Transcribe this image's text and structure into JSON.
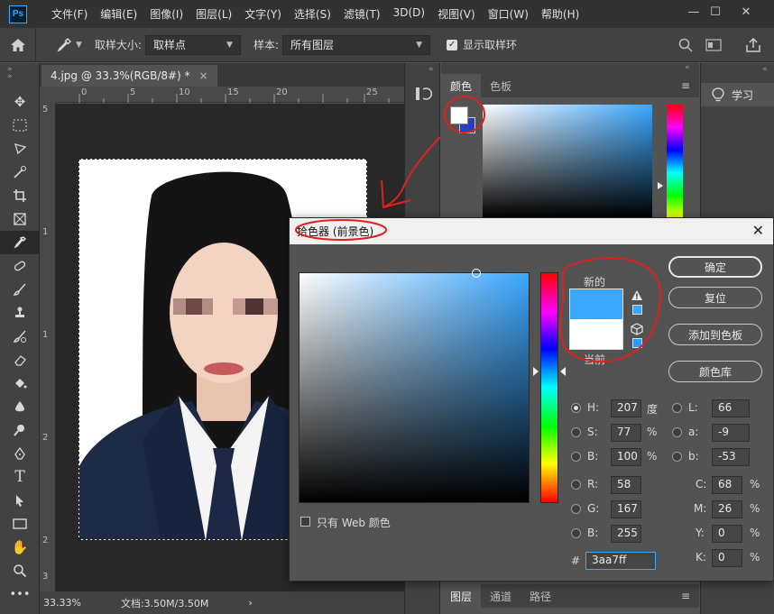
{
  "app": {
    "logo": "Ps"
  },
  "menu": [
    "文件(F)",
    "编辑(E)",
    "图像(I)",
    "图层(L)",
    "文字(Y)",
    "选择(S)",
    "滤镜(T)",
    "3D(D)",
    "视图(V)",
    "窗口(W)",
    "帮助(H)"
  ],
  "window": {
    "minimize": "—",
    "maximize": "☐",
    "close": "✕"
  },
  "options": {
    "sample_size_label": "取样大小:",
    "sample_size_value": "取样点",
    "sample_label": "样本:",
    "sample_value": "所有图层",
    "show_ring_label": "显示取样环",
    "show_ring_checked": "✓"
  },
  "document": {
    "tab_title": "4.jpg @ 33.3%(RGB/8#) *",
    "tab_close": "×",
    "ruler_h": [
      "0",
      "5",
      "10",
      "15",
      "20",
      "25"
    ],
    "ruler_v": [
      "5",
      "1",
      "1",
      "2",
      "2",
      "3"
    ],
    "zoom": "33.33%",
    "doc_size": "文档:3.50M/3.50M",
    "status_arrow": "›"
  },
  "color_panel": {
    "tabs": [
      "颜色",
      "色板"
    ],
    "menu_icon": "≡",
    "bottom_tabs": [
      "图层",
      "通道",
      "路径"
    ]
  },
  "learn_panel": {
    "label": "学习"
  },
  "dialog": {
    "title": "拾色器 (前景色)",
    "close": "✕",
    "new_label": "新的",
    "current_label": "当前",
    "new_color": "#3aa7ff",
    "current_color": "#ffffff",
    "buttons": {
      "ok": "确定",
      "reset": "复位",
      "add_to_swatches": "添加到色板",
      "color_libraries": "颜色库"
    },
    "web_only_label": "只有 Web 颜色",
    "hsb": {
      "h_label": "H:",
      "h_value": "207",
      "h_unit": "度",
      "s_label": "S:",
      "s_value": "77",
      "s_unit": "%",
      "b_label": "B:",
      "b_value": "100",
      "b_unit": "%"
    },
    "rgb": {
      "r_label": "R:",
      "r_value": "58",
      "g_label": "G:",
      "g_value": "167",
      "b_label": "B:",
      "b_value": "255"
    },
    "lab": {
      "l_label": "L:",
      "l_value": "66",
      "a_label": "a:",
      "a_value": "-9",
      "b_label": "b:",
      "b_value": "-53"
    },
    "cmyk": {
      "c_label": "C:",
      "c_value": "68",
      "m_label": "M:",
      "m_value": "26",
      "y_label": "Y:",
      "y_value": "0",
      "k_label": "K:",
      "k_value": "0",
      "unit": "%"
    },
    "hex_label": "#",
    "hex_value": "3aa7ff"
  },
  "accent": "#31a8ff",
  "annotation_color": "#e02020"
}
